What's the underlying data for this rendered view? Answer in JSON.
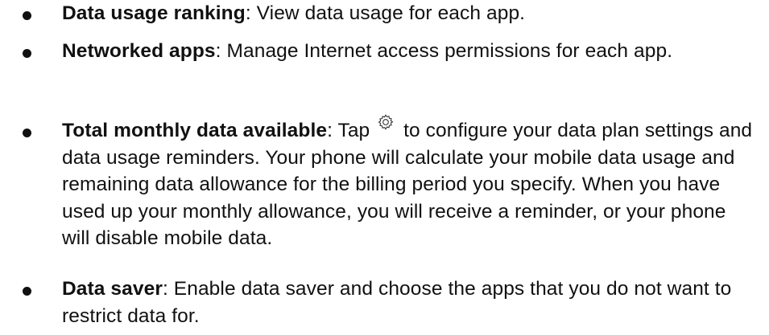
{
  "items": [
    {
      "term": "Data usage ranking",
      "sep": ":",
      "text": " View data usage for each app."
    },
    {
      "term": "Networked apps",
      "sep": ":",
      "text": " Manage Internet access permissions for each app."
    },
    {
      "term": "Total monthly data available",
      "sep": ":",
      "text_before": " Tap ",
      "icon": "gear-icon",
      "text_after": " to configure your data plan settings and data usage reminders. Your phone will calculate your mobile data usage and remaining data allowance for the billing period you specify. When you have used up your monthly allowance, you will receive a reminder, or your phone will disable mobile data."
    },
    {
      "term": "Data saver",
      "sep": ":",
      "text": " Enable data saver and choose the apps that you do not want to restrict data for."
    }
  ]
}
